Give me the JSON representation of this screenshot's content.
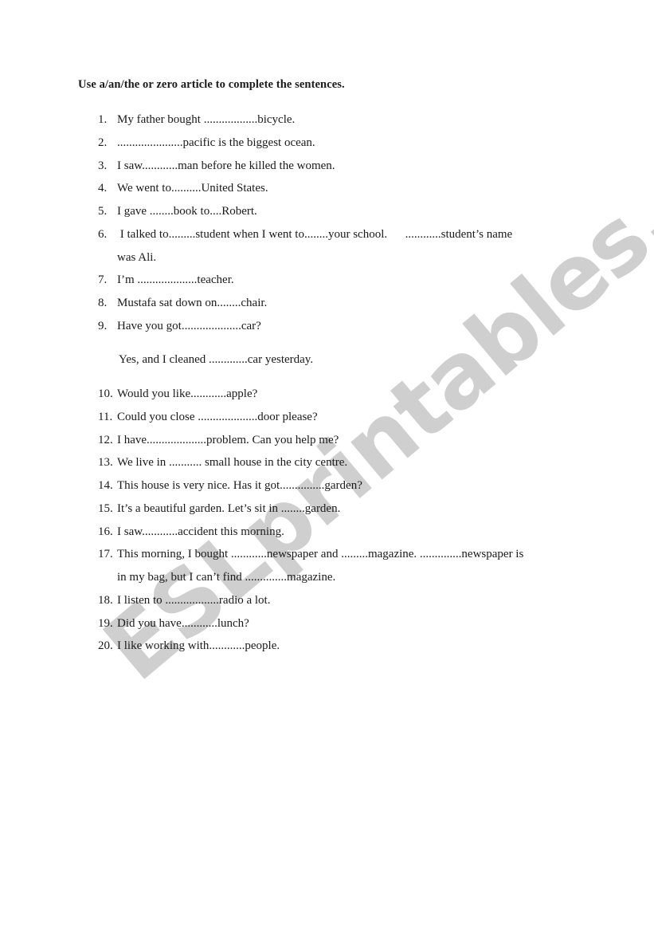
{
  "worksheet": {
    "instructions": "Use a/an/the or zero article to complete the sentences.",
    "watermark": "ESLprintables.com",
    "items": [
      {
        "number": "1.",
        "text": "My father bought ..................bicycle."
      },
      {
        "number": "2.",
        "text": "......................pacific is the biggest ocean."
      },
      {
        "number": "3.",
        "text": "I saw............man before he killed the women."
      },
      {
        "number": "4.",
        "text": "We went to..........United States."
      },
      {
        "number": "5.",
        "text": "I gave ........book to....Robert."
      },
      {
        "number": "6.",
        "text": " I talked to.........student when I went to........your school.      ............student’s name",
        "continuation": "was Ali."
      },
      {
        "number": "7.",
        "text": "I’m ....................teacher."
      },
      {
        "number": "8.",
        "text": "Mustafa sat down on........chair."
      },
      {
        "number": "9.",
        "text": "Have you got....................car?",
        "continuation": "Yes, and I cleaned .............car yesterday."
      },
      {
        "number": "10.",
        "text": "Would you like............apple?"
      },
      {
        "number": "11.",
        "text": "Could you close ....................door please?"
      },
      {
        "number": "12.",
        "text": "I have....................problem. Can you help me?"
      },
      {
        "number": "13.",
        "text": "We live in ........... small house in the city centre."
      },
      {
        "number": "14.",
        "text": "This house is very nice. Has it got...............garden?"
      },
      {
        "number": "15.",
        "text": "It’s a beautiful garden. Let’s sit in ........garden."
      },
      {
        "number": "16.",
        "text": "I saw............accident this morning."
      },
      {
        "number": "17.",
        "text": "This morning, I bought ............newspaper and .........magazine. ..............newspaper is",
        "continuation": "in my bag, but I can’t find ..............magazine."
      },
      {
        "number": "18.",
        "text": "I listen to ..................radio a lot."
      },
      {
        "number": "19.",
        "text": "Did you have............lunch?"
      },
      {
        "number": "20.",
        "text": "I like working with............people."
      }
    ]
  }
}
